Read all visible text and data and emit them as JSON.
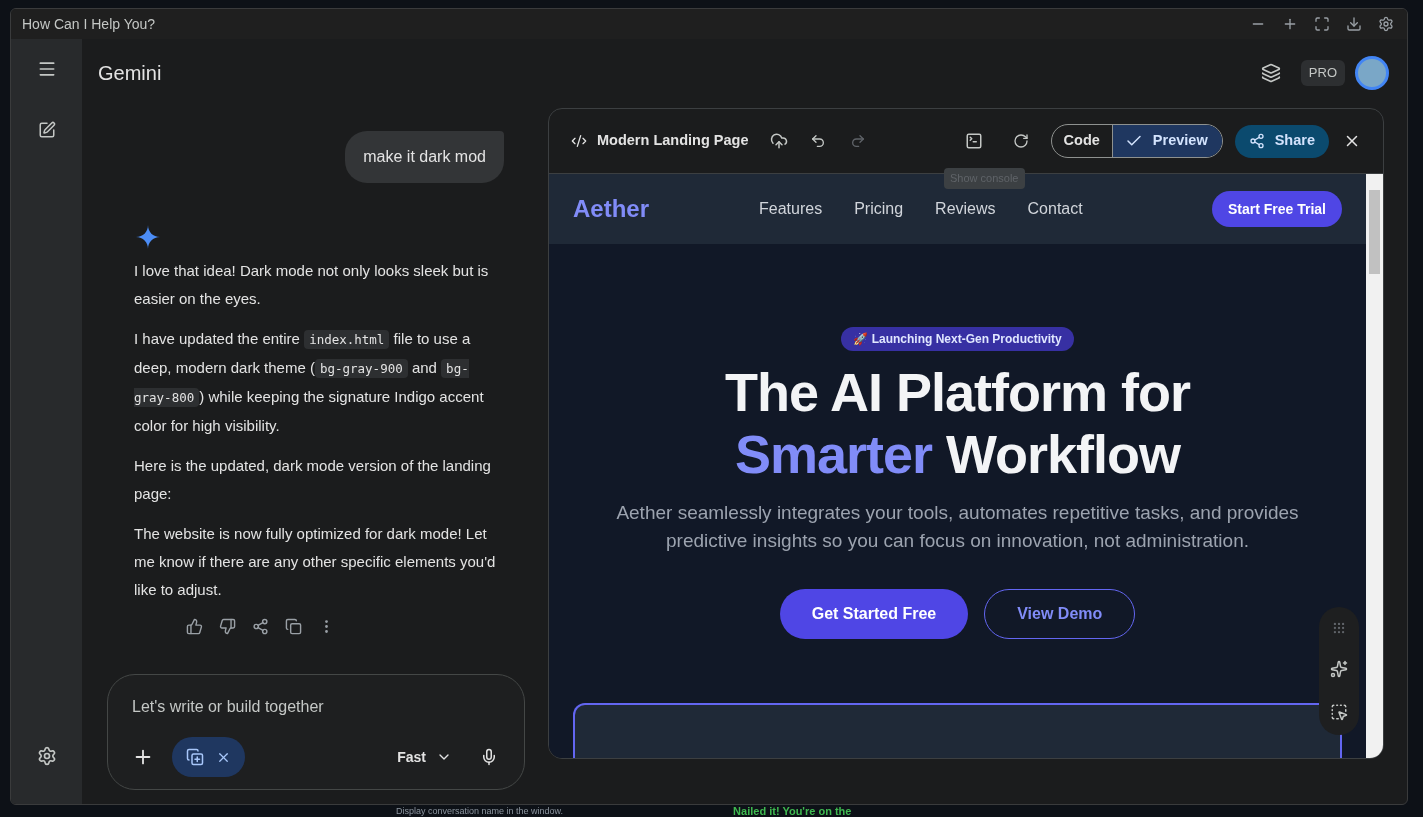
{
  "window": {
    "title": "How Can I Help You?"
  },
  "app": {
    "name": "Gemini",
    "badge": "PRO"
  },
  "chat": {
    "user_message": "make it dark mod",
    "paragraphs": [
      [
        {
          "text": "I love that idea! Dark mode not only looks sleek but is easier on the eyes.",
          "kind": "text"
        }
      ],
      [
        {
          "text": "I have updated the entire ",
          "kind": "text"
        },
        {
          "text": "index.html",
          "kind": "code"
        },
        {
          "text": " file to use a deep, modern dark theme (",
          "kind": "text"
        },
        {
          "text": "bg-gray-900",
          "kind": "code"
        },
        {
          "text": " and ",
          "kind": "text"
        },
        {
          "text": "bg-gray-800",
          "kind": "code"
        },
        {
          "text": ") while keeping the signature Indigo accent color for high visibility.",
          "kind": "text"
        }
      ],
      [
        {
          "text": "Here is the updated, dark mode version of the landing page:",
          "kind": "text"
        }
      ],
      [
        {
          "text": "The website is now fully optimized for dark mode! Let me know if there are any other specific elements you'd like to adjust.",
          "kind": "text"
        }
      ]
    ]
  },
  "composer": {
    "placeholder": "Let's write or build together",
    "mode": "Fast"
  },
  "preview": {
    "title": "Modern Landing Page",
    "tooltip": "Show console",
    "view_tabs": [
      {
        "label": "Code",
        "selected": false
      },
      {
        "label": "Preview",
        "selected": true
      }
    ],
    "share": "Share",
    "site": {
      "logo": "Aether",
      "nav": [
        "Features",
        "Pricing",
        "Reviews",
        "Contact"
      ],
      "cta": "Start Free Trial",
      "badge": "🚀 Launching Next-Gen Productivity",
      "heading": [
        [
          {
            "text": "The AI Platform for",
            "kind": "plain"
          }
        ],
        [
          {
            "text": "Smarter",
            "kind": "accent"
          },
          {
            "text": " Workflow",
            "kind": "plain"
          }
        ]
      ],
      "subtitle": "Aether seamlessly integrates your tools, automates repetitive tasks, and provides predictive insights so you can focus on innovation, not administration.",
      "buttons": [
        {
          "label": "Get Started Free",
          "kind": "primary"
        },
        {
          "label": "View Demo",
          "kind": "outline"
        }
      ]
    }
  },
  "background": {
    "texts": [
      "Display conversation name in the window.",
      "Nailed it! You're on the"
    ]
  }
}
